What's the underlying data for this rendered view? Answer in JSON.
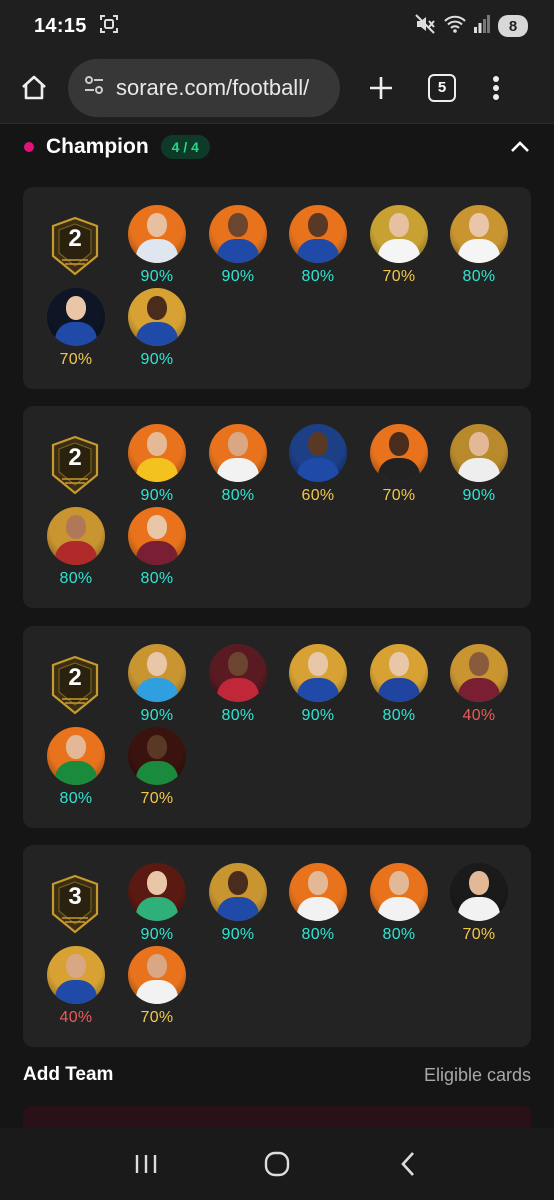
{
  "status_bar": {
    "time": "14:15",
    "battery": "8"
  },
  "browser": {
    "url": "sorare.com/football/",
    "tab_count": "5"
  },
  "section": {
    "title": "Champion",
    "count": "4 / 4"
  },
  "teams": [
    {
      "level": "2",
      "players": [
        {
          "pct": "90%",
          "pct_color": "#2ee6d3",
          "bg": "#e8731c",
          "shirt": "#dfe6ef",
          "skin": "#e9bfa2"
        },
        {
          "pct": "90%",
          "pct_color": "#2ee6d3",
          "bg": "#e8731c",
          "shirt": "#1f4aa8",
          "skin": "#6b4530"
        },
        {
          "pct": "80%",
          "pct_color": "#2ee6d3",
          "bg": "#e8731c",
          "shirt": "#1f4aa8",
          "skin": "#5a3826"
        },
        {
          "pct": "70%",
          "pct_color": "#f2c84b",
          "bg": "#c7a232",
          "shirt": "#f5f5f5",
          "skin": "#e6c0a0"
        },
        {
          "pct": "80%",
          "pct_color": "#2ee6d3",
          "bg": "#c99531",
          "shirt": "#f5f5f5",
          "skin": "#e9c6a8"
        },
        {
          "pct": "70%",
          "pct_color": "#f2c84b",
          "bg": "#0e1524",
          "shirt": "#1f4aa8",
          "skin": "#e9c6a8"
        },
        {
          "pct": "90%",
          "pct_color": "#2ee6d3",
          "bg": "#d7a233",
          "shirt": "#1f4aa8",
          "skin": "#4a2c1c"
        }
      ]
    },
    {
      "level": "2",
      "players": [
        {
          "pct": "90%",
          "pct_color": "#2ee6d3",
          "bg": "#e8731c",
          "shirt": "#f4c21f",
          "skin": "#e5b896"
        },
        {
          "pct": "80%",
          "pct_color": "#2ee6d3",
          "bg": "#e8731c",
          "shirt": "#f2f2f2",
          "skin": "#d9a784"
        },
        {
          "pct": "60%",
          "pct_color": "#f2c84b",
          "bg": "#1d3f86",
          "shirt": "#1f4aa8",
          "skin": "#5a3826"
        },
        {
          "pct": "70%",
          "pct_color": "#f2c84b",
          "bg": "#e8731c",
          "shirt": "#222222",
          "skin": "#4a2c1c"
        },
        {
          "pct": "90%",
          "pct_color": "#2ee6d3",
          "bg": "#b98a2c",
          "shirt": "#eeeeee",
          "skin": "#e2b896"
        },
        {
          "pct": "80%",
          "pct_color": "#2ee6d3",
          "bg": "#c99531",
          "shirt": "#b02a2a",
          "skin": "#b07858"
        },
        {
          "pct": "80%",
          "pct_color": "#2ee6d3",
          "bg": "#e8731c",
          "shirt": "#7a1f33",
          "skin": "#e9c6a8"
        }
      ]
    },
    {
      "level": "2",
      "players": [
        {
          "pct": "90%",
          "pct_color": "#2ee6d3",
          "bg": "#c99531",
          "shirt": "#2f9fe0",
          "skin": "#e9c6a8"
        },
        {
          "pct": "80%",
          "pct_color": "#2ee6d3",
          "bg": "#5a1a22",
          "shirt": "#c0283a",
          "skin": "#6b4530"
        },
        {
          "pct": "90%",
          "pct_color": "#2ee6d3",
          "bg": "#d7a233",
          "shirt": "#1f4aa8",
          "skin": "#e9c6a8"
        },
        {
          "pct": "80%",
          "pct_color": "#2ee6d3",
          "bg": "#d7a233",
          "shirt": "#2045a0",
          "skin": "#e9c6a8"
        },
        {
          "pct": "40%",
          "pct_color": "#ef5a5a",
          "bg": "#c99531",
          "shirt": "#7a1f33",
          "skin": "#8a5a3c"
        },
        {
          "pct": "80%",
          "pct_color": "#2ee6d3",
          "bg": "#e8731c",
          "shirt": "#1a8a3c",
          "skin": "#e2b896"
        },
        {
          "pct": "70%",
          "pct_color": "#f2c84b",
          "bg": "#3a120e",
          "shirt": "#1a8a3c",
          "skin": "#5a3826"
        }
      ]
    },
    {
      "level": "3",
      "players": [
        {
          "pct": "90%",
          "pct_color": "#2ee6d3",
          "bg": "#5a1a12",
          "shirt": "#2fb07a",
          "skin": "#e9c6a8"
        },
        {
          "pct": "90%",
          "pct_color": "#2ee6d3",
          "bg": "#c99531",
          "shirt": "#1f4aa8",
          "skin": "#4a2c1c"
        },
        {
          "pct": "80%",
          "pct_color": "#2ee6d3",
          "bg": "#e8731c",
          "shirt": "#f2f2f2",
          "skin": "#e2b896"
        },
        {
          "pct": "80%",
          "pct_color": "#2ee6d3",
          "bg": "#e8731c",
          "shirt": "#f2f2f2",
          "skin": "#e2b896"
        },
        {
          "pct": "70%",
          "pct_color": "#f2c84b",
          "bg": "#1a1a1a",
          "shirt": "#f2f2f2",
          "skin": "#e2b896"
        },
        {
          "pct": "40%",
          "pct_color": "#ef5a5a",
          "bg": "#d7a233",
          "shirt": "#1f4aa8",
          "skin": "#d9a784"
        },
        {
          "pct": "70%",
          "pct_color": "#f2c84b",
          "bg": "#e8731c",
          "shirt": "#f2f2f2",
          "skin": "#d9a784"
        }
      ]
    }
  ],
  "add_team": {
    "title": "Add Team",
    "eligible": "Eligible cards"
  },
  "icons": {
    "home": "home-icon",
    "site_info": "site-info-icon",
    "new_tab": "plus-icon",
    "menu": "more-vert-icon",
    "collapse": "chevron-up-icon",
    "nav_recents": "recents-icon",
    "nav_home": "nav-home-icon",
    "nav_back": "back-icon",
    "mute": "mute-icon",
    "wifi": "wifi-icon",
    "signal": "signal-icon",
    "screenshot": "screenshot-icon"
  },
  "colors": {
    "accent_pink": "#e3127a",
    "badge_green": "#27d58a",
    "pct_teal": "#2ee6d3",
    "pct_yellow": "#f2c84b",
    "pct_red": "#ef5a5a"
  }
}
